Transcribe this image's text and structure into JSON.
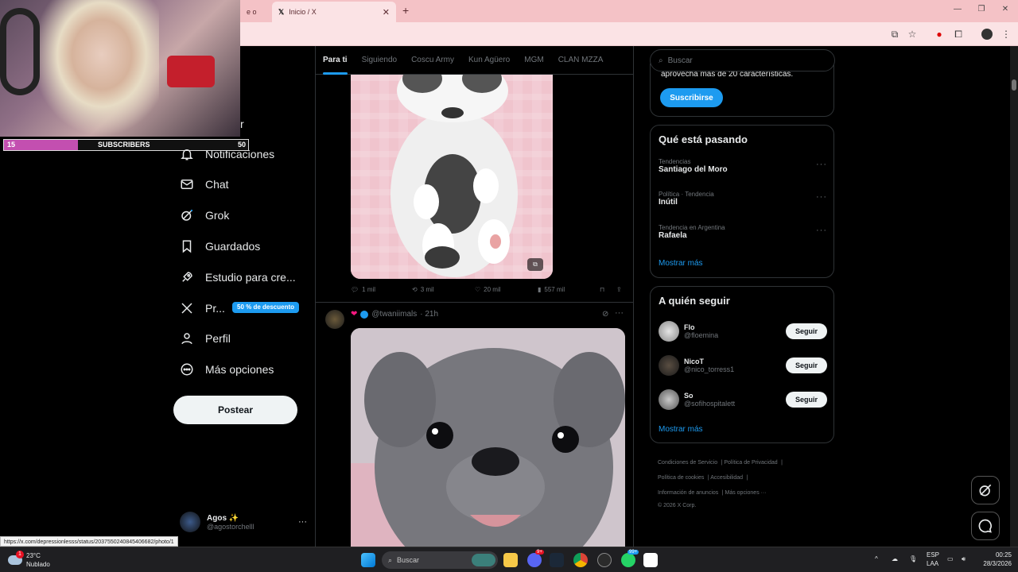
{
  "browser": {
    "tabs": [
      {
        "label": "e o",
        "active": false
      },
      {
        "label": "Inicio / X",
        "active": true
      }
    ],
    "new_tab": "+"
  },
  "overlay": {
    "sub_count": "15",
    "sub_label": "SUBSCRIBERS",
    "sub_goal": "50"
  },
  "sidebar": {
    "partial_label": "r",
    "items": [
      {
        "label": "Notificaciones",
        "icon": "bell-icon"
      },
      {
        "label": "Chat",
        "icon": "mail-icon"
      },
      {
        "label": "Grok",
        "icon": "grok-icon"
      },
      {
        "label": "Guardados",
        "icon": "bookmark-icon"
      },
      {
        "label": "Estudio para cre...",
        "icon": "rocket-icon"
      },
      {
        "label": "Pr...",
        "icon": "x-logo-icon"
      },
      {
        "label": "Perfil",
        "icon": "person-icon"
      },
      {
        "label": "Más opciones",
        "icon": "more-circle-icon"
      }
    ],
    "premium_badge": "50 % de descuento",
    "post_button": "Postear",
    "account": {
      "name": "Agos ✨",
      "handle": "@agostorchelll",
      "more": "···"
    }
  },
  "feed": {
    "tabs": [
      "Para ti",
      "Siguiendo",
      "Coscu Army",
      "Kun Agüero",
      "MGM",
      "CLAN MZZA"
    ],
    "post1_actions": {
      "replies": "1 mil",
      "reposts": "3 mil",
      "likes": "20 mil",
      "views": "557 mil"
    },
    "post2": {
      "handle": "@twaniimals",
      "time": "· 21h",
      "more": "···"
    }
  },
  "right": {
    "search_placeholder": "Buscar",
    "premium_text": "aprovecha más de 20 características.",
    "subscribe_button": "Suscribirse",
    "trends_title": "Qué está pasando",
    "trends": [
      {
        "meta": "Tendencias",
        "name": "Santiago del Moro"
      },
      {
        "meta": "Política · Tendencia",
        "name": "Inútil"
      },
      {
        "meta": "Tendencia en Argentina",
        "name": "Rafaela"
      }
    ],
    "show_more": "Mostrar más",
    "follow_title": "A quién seguir",
    "follow": [
      {
        "name": "Flo",
        "handle": "@floemina",
        "button": "Seguir"
      },
      {
        "name": "NicoT",
        "handle": "@nico_torress1",
        "button": "Seguir"
      },
      {
        "name": "So",
        "handle": "@sofihospitalett",
        "button": "Seguir"
      }
    ],
    "footer": {
      "l1a": "Condiciones de Servicio",
      "l1b": "Política de Privacidad",
      "l2a": "Política de cookies",
      "l2b": "Accesibilidad",
      "l3a": "Información de anuncios",
      "l3b": "Más opciones ···",
      "copy": "© 2026 X Corp."
    }
  },
  "status_url": "https://x.com/depressionlesss/status/2037550240845406682/photo/1",
  "taskbar": {
    "weather_temp": "23°C",
    "weather_desc": "Nublado",
    "search_placeholder": "Buscar",
    "lang1": "ESP",
    "lang2": "LAA",
    "time": "00:25",
    "date": "28/3/2026",
    "badge_weather": "1",
    "badge_discord": "9+",
    "badge_whatsapp": "99+"
  }
}
